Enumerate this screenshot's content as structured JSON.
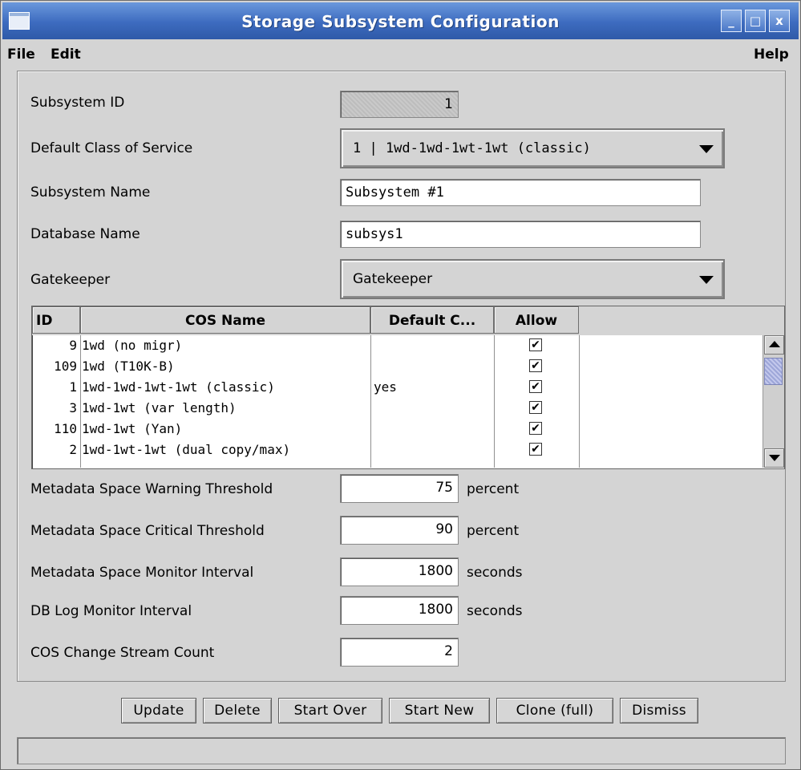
{
  "window": {
    "title": "Storage Subsystem Configuration",
    "controls": {
      "minimize": "_",
      "maximize": "□",
      "close": "x"
    }
  },
  "menubar": {
    "file": "File",
    "edit": "Edit",
    "help": "Help"
  },
  "form": {
    "subsystem_id": {
      "label": "Subsystem ID",
      "value": "1"
    },
    "default_cos": {
      "label": "Default Class of Service",
      "value": "1 | 1wd-1wd-1wt-1wt (classic)"
    },
    "subsystem_name": {
      "label": "Subsystem Name",
      "value": "Subsystem #1"
    },
    "database_name": {
      "label": "Database Name",
      "value": "subsys1"
    },
    "gatekeeper": {
      "label": "Gatekeeper",
      "value": "Gatekeeper"
    }
  },
  "cos_table": {
    "columns": [
      "ID",
      "COS Name",
      "Default C...",
      "Allow"
    ],
    "rows": [
      {
        "id": "9",
        "name": "1wd (no migr)",
        "default": "",
        "allow": true
      },
      {
        "id": "109",
        "name": "1wd (T10K-B)",
        "default": "",
        "allow": true
      },
      {
        "id": "1",
        "name": "1wd-1wd-1wt-1wt (classic)",
        "default": "yes",
        "allow": true
      },
      {
        "id": "3",
        "name": "1wd-1wt (var length)",
        "default": "",
        "allow": true
      },
      {
        "id": "110",
        "name": "1wd-1wt (Yan)",
        "default": "",
        "allow": true
      },
      {
        "id": "2",
        "name": "1wd-1wt-1wt (dual copy/max)",
        "default": "",
        "allow": true
      }
    ]
  },
  "thresholds": {
    "warning": {
      "label": "Metadata Space Warning Threshold",
      "value": "75",
      "unit": "percent"
    },
    "critical": {
      "label": "Metadata Space Critical Threshold",
      "value": "90",
      "unit": "percent"
    },
    "monitor_interval": {
      "label": "Metadata Space Monitor Interval",
      "value": "1800",
      "unit": "seconds"
    },
    "db_log_interval": {
      "label": "DB Log Monitor Interval",
      "value": "1800",
      "unit": "seconds"
    },
    "cos_stream_count": {
      "label": "COS Change Stream Count",
      "value": "2"
    }
  },
  "buttons": {
    "update": "Update",
    "delete": "Delete",
    "start_over": "Start Over",
    "start_new": "Start New",
    "clone_full": "Clone (full)",
    "dismiss": "Dismiss"
  },
  "checkmark_glyph": "✔",
  "status": ""
}
